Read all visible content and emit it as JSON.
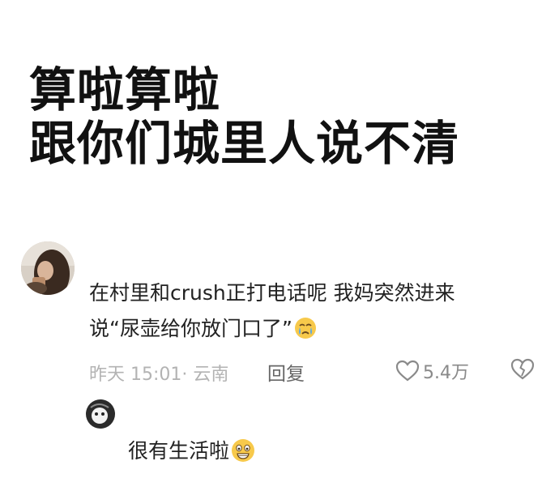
{
  "headline": {
    "line1": "算啦算啦",
    "line2": "跟你们城里人说不清"
  },
  "comment": {
    "line1": "在村里和crush正打电话呢 我妈突然进来",
    "line2": "说“尿壶给你放门口了”",
    "emoji": "crying-face-icon",
    "time": "昨天 15:01",
    "location_separator": "·",
    "location": "云南",
    "reply_label": "回复",
    "likes": "5.4万"
  },
  "sub_reply": {
    "text": "很有生活啦",
    "emoji": "grinning-face-icon"
  },
  "colors": {
    "text": "#222222",
    "meta": "#b3b3b3",
    "reply_label": "#666666",
    "emoji_yellow": "#f7c94b"
  }
}
